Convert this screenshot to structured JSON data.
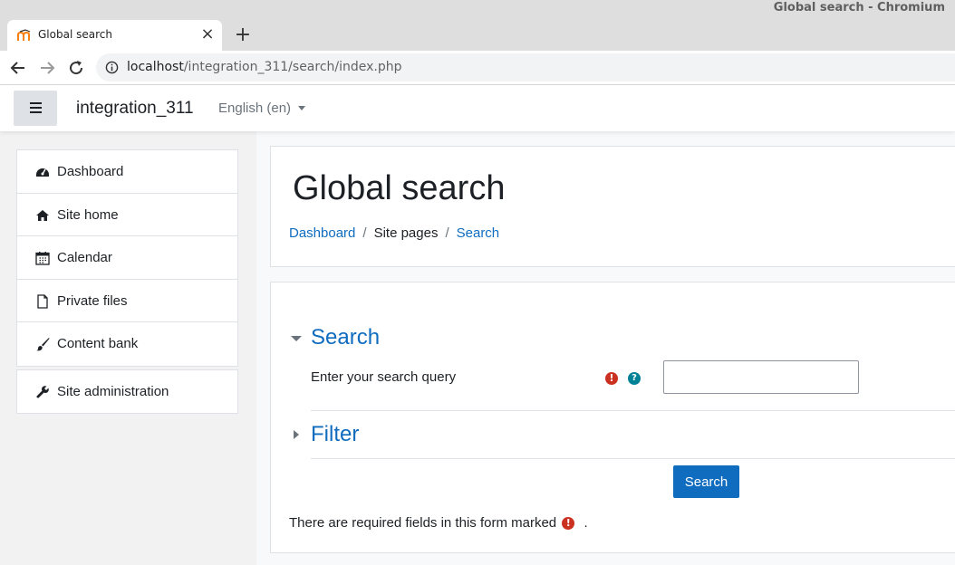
{
  "browser": {
    "window_title": "Global search - Chromium",
    "tab_title": "Global search",
    "url_host": "localhost",
    "url_path": "/integration_311/search/index.php",
    "icons": {
      "back": "back-arrow-icon",
      "forward": "forward-arrow-icon",
      "reload": "reload-icon",
      "info": "info-icon",
      "close": "close-icon",
      "new_tab": "plus-icon"
    }
  },
  "navbar": {
    "site_name": "integration_311",
    "language": "English (en)"
  },
  "sidebar": {
    "items": [
      {
        "label": "Dashboard",
        "icon": "dashboard-icon"
      },
      {
        "label": "Site home",
        "icon": "home-icon"
      },
      {
        "label": "Calendar",
        "icon": "calendar-icon"
      },
      {
        "label": "Private files",
        "icon": "file-icon"
      },
      {
        "label": "Content bank",
        "icon": "paintbrush-icon"
      }
    ],
    "admin": {
      "label": "Site administration",
      "icon": "wrench-icon"
    }
  },
  "header": {
    "title": "Global search",
    "breadcrumb": [
      {
        "label": "Dashboard",
        "link": true
      },
      {
        "label": "Site pages",
        "link": false
      },
      {
        "label": "Search",
        "link": true
      }
    ]
  },
  "form": {
    "search_section": "Search",
    "search_label": "Enter your search query",
    "search_value": "",
    "filter_section": "Filter",
    "submit_label": "Search",
    "required_note_prefix": "There are required fields in this form marked",
    "required_note_suffix": "."
  },
  "colors": {
    "primary": "#0f6cbf",
    "required": "#ca3120",
    "help": "#008196"
  }
}
